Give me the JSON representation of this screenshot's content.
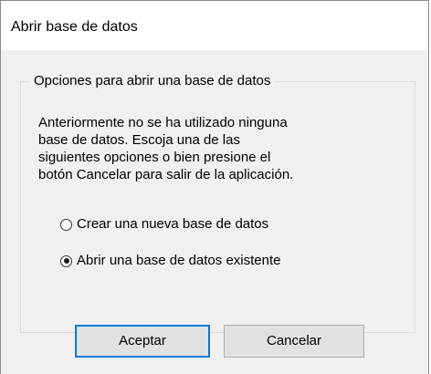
{
  "window": {
    "title": "Abrir base de datos"
  },
  "group": {
    "legend": "Opciones para abrir una base de datos",
    "description": "Anteriormente no se ha utilizado ninguna\nbase de datos. Escoja una de las\nsiguientes opciones o bien presione el\nbotón Cancelar para salir de la aplicación."
  },
  "options": [
    {
      "label": "Crear una nueva base de datos",
      "selected": false
    },
    {
      "label": "Abrir una base de datos existente",
      "selected": true
    }
  ],
  "buttons": {
    "ok_label": "Aceptar",
    "cancel_label": "Cancelar"
  },
  "colors": {
    "dialog_background": "#f0f0f0",
    "titlebar_background": "#ffffff",
    "default_button_border": "#0078d7",
    "button_face": "#e1e1e1"
  }
}
